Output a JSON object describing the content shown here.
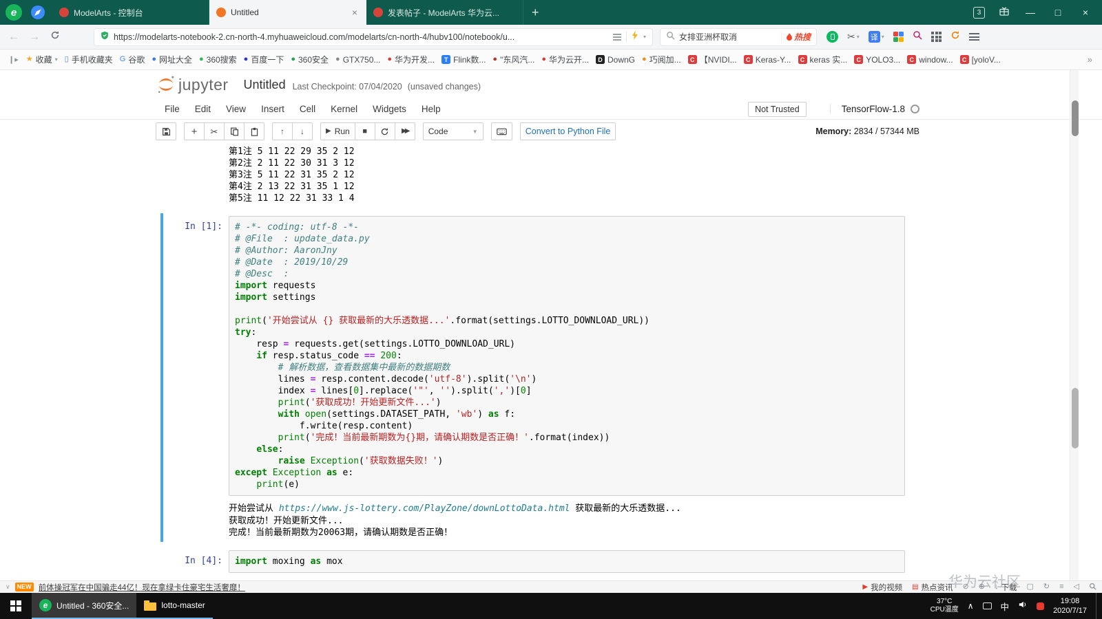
{
  "browser": {
    "tabs": {
      "tab1": {
        "title": "ModelArts - 控制台"
      },
      "tab2": {
        "title": "Untitled"
      },
      "tab3": {
        "title": "发表帖子 - ModelArts 华为云..."
      },
      "count_badge": "3"
    },
    "address": {
      "url": "https://modelarts-notebook-2.cn-north-4.myhuaweicloud.com/modelarts/cn-north-4/hubv100/notebook/u...",
      "search_text": "女排亚洲杯取消",
      "hot_label": "热搜",
      "translate_label": "译"
    },
    "bookmarks": [
      {
        "glyph": "★",
        "color": "#f5a623",
        "label": "收藏",
        "caret": "▾"
      },
      {
        "glyph": "▯",
        "color": "#4a90d9",
        "label": "手机收藏夹"
      },
      {
        "glyph": "G",
        "color": "#4285f4",
        "label": "谷歌"
      },
      {
        "glyph": "●",
        "color": "#3b78e7",
        "label": "网址大全"
      },
      {
        "glyph": "●",
        "color": "#2fb457",
        "label": "360搜索"
      },
      {
        "glyph": "●",
        "color": "#2932e1",
        "label": "百度一下"
      },
      {
        "glyph": "●",
        "color": "#25a35a",
        "label": "360安全"
      },
      {
        "glyph": "●",
        "color": "#8a8a8a",
        "label": "GTX750..."
      },
      {
        "glyph": "●",
        "color": "#d43f3a",
        "label": "华为开发..."
      },
      {
        "badge": "T",
        "bg": "#2d7ff9",
        "label": "Flink数..."
      },
      {
        "glyph": "●",
        "color": "#b03a2e",
        "label": "\"东风汽..."
      },
      {
        "glyph": "●",
        "color": "#d43f3a",
        "label": "华为云开..."
      },
      {
        "badge": "D",
        "bg": "#222222",
        "label": "DownG"
      },
      {
        "glyph": "●",
        "color": "#f08a24",
        "label": "巧阅加..."
      },
      {
        "badge": "C",
        "bg": "#dd3c3c",
        "label": "【NVIDI..."
      },
      {
        "badge": "C",
        "bg": "#dd3c3c",
        "label": "Keras-Y..."
      },
      {
        "badge": "C",
        "bg": "#dd3c3c",
        "label": "keras 实..."
      },
      {
        "badge": "C",
        "bg": "#dd3c3c",
        "label": "YOLO3..."
      },
      {
        "badge": "C",
        "bg": "#dd3c3c",
        "label": "window..."
      },
      {
        "badge": "C",
        "bg": "#dd3c3c",
        "label": "[yoloV..."
      }
    ],
    "news": {
      "badge": "NEW",
      "headline": "前体操冠军在中国骗走44亿！现在拿绿卡住豪宅生活奢靡！",
      "my_videos": "我的视频",
      "hot_news": "热点资讯",
      "download": "下载"
    }
  },
  "jupyter": {
    "logo_text": "jupyter",
    "title": "Untitled",
    "checkpoint": "Last Checkpoint: 07/04/2020",
    "unsaved": "(unsaved changes)",
    "menus": [
      "File",
      "Edit",
      "View",
      "Insert",
      "Cell",
      "Kernel",
      "Widgets",
      "Help"
    ],
    "not_trusted": "Not Trusted",
    "kernel_name": "TensorFlow-1.8",
    "toolbar": {
      "run_label": "Run",
      "cell_type": "Code",
      "convert_label": "Convert to Python File",
      "memory_label": "Memory:",
      "memory_value": "2834 / 57344 MB"
    },
    "cells": {
      "prev_output": [
        "第1注 5 11 22 29 35 2 12",
        "第2注 2 11 22 30 31 3 12",
        "第3注 5 11 22 31 35 2 12",
        "第4注 2 13 22 31 35 1 12",
        "第5注 11 12 22 31 33 1 4"
      ],
      "cell1": {
        "prompt": "In [1]:",
        "code_lines": [
          [
            [
              "c",
              "# -*- coding: utf-8 -*-"
            ]
          ],
          [
            [
              "c",
              "# @File  : update_data.py"
            ]
          ],
          [
            [
              "c",
              "# @Author: AaronJny"
            ]
          ],
          [
            [
              "c",
              "# @Date  : 2019/10/29"
            ]
          ],
          [
            [
              "c",
              "# @Desc  :"
            ]
          ],
          [
            [
              "k",
              "import"
            ],
            [
              "p",
              " requests"
            ]
          ],
          [
            [
              "k",
              "import"
            ],
            [
              "p",
              " settings"
            ]
          ],
          [
            [
              "p",
              ""
            ]
          ],
          [
            [
              "b",
              "print"
            ],
            [
              "p",
              "("
            ],
            [
              "s",
              "'开始尝试从 {} 获取最新的大乐透数据...'"
            ],
            [
              "p",
              ".format(settings.LOTTO_DOWNLOAD_URL))"
            ]
          ],
          [
            [
              "k",
              "try"
            ],
            [
              "p",
              ":"
            ]
          ],
          [
            [
              "p",
              "    resp "
            ],
            [
              "o",
              "="
            ],
            [
              "p",
              " requests.get(settings.LOTTO_DOWNLOAD_URL)"
            ]
          ],
          [
            [
              "p",
              "    "
            ],
            [
              "k",
              "if"
            ],
            [
              "p",
              " resp.status_code "
            ],
            [
              "o",
              "=="
            ],
            [
              "p",
              " "
            ],
            [
              "n",
              "200"
            ],
            [
              "p",
              ":"
            ]
          ],
          [
            [
              "p",
              "        "
            ],
            [
              "c",
              "# 解析数据，查看数据集中最新的数据期数"
            ]
          ],
          [
            [
              "p",
              "        lines "
            ],
            [
              "o",
              "="
            ],
            [
              "p",
              " resp.content.decode("
            ],
            [
              "s",
              "'utf-8'"
            ],
            [
              "p",
              ").split("
            ],
            [
              "s",
              "'\\n'"
            ],
            [
              "p",
              ")"
            ]
          ],
          [
            [
              "p",
              "        index "
            ],
            [
              "o",
              "="
            ],
            [
              "p",
              " lines["
            ],
            [
              "n",
              "0"
            ],
            [
              "p",
              "].replace("
            ],
            [
              "s",
              "'\"'"
            ],
            [
              "p",
              ", "
            ],
            [
              "s",
              "''"
            ],
            [
              "p",
              ").split("
            ],
            [
              "s",
              "','"
            ],
            [
              "p",
              ")["
            ],
            [
              "n",
              "0"
            ],
            [
              "p",
              "]"
            ]
          ],
          [
            [
              "p",
              "        "
            ],
            [
              "b",
              "print"
            ],
            [
              "p",
              "("
            ],
            [
              "s",
              "'获取成功！开始更新文件...'"
            ],
            [
              "p",
              ")"
            ]
          ],
          [
            [
              "p",
              "        "
            ],
            [
              "k",
              "with"
            ],
            [
              "p",
              " "
            ],
            [
              "b",
              "open"
            ],
            [
              "p",
              "(settings.DATASET_PATH, "
            ],
            [
              "s",
              "'wb'"
            ],
            [
              "p",
              ") "
            ],
            [
              "k",
              "as"
            ],
            [
              "p",
              " f:"
            ]
          ],
          [
            [
              "p",
              "            f.write(resp.content)"
            ]
          ],
          [
            [
              "p",
              "        "
            ],
            [
              "b",
              "print"
            ],
            [
              "p",
              "("
            ],
            [
              "s",
              "'完成！当前最新期数为{}期，请确认期数是否正确！'"
            ],
            [
              "p",
              ".format(index))"
            ]
          ],
          [
            [
              "p",
              "    "
            ],
            [
              "k",
              "else"
            ],
            [
              "p",
              ":"
            ]
          ],
          [
            [
              "p",
              "        "
            ],
            [
              "k",
              "raise"
            ],
            [
              "p",
              " "
            ],
            [
              "b",
              "Exception"
            ],
            [
              "p",
              "("
            ],
            [
              "s",
              "'获取数据失败！'"
            ],
            [
              "p",
              ")"
            ]
          ],
          [
            [
              "k",
              "except"
            ],
            [
              "p",
              " "
            ],
            [
              "b",
              "Exception"
            ],
            [
              "p",
              " "
            ],
            [
              "k",
              "as"
            ],
            [
              "p",
              " e:"
            ]
          ],
          [
            [
              "p",
              "    "
            ],
            [
              "b",
              "print"
            ],
            [
              "p",
              "(e)"
            ]
          ]
        ],
        "output_lines": [
          [
            [
              "p",
              "开始尝试从 "
            ],
            [
              "url",
              "https://www.js-lottery.com/PlayZone/downLottoData.html"
            ],
            [
              "p",
              " 获取最新的大乐透数据..."
            ]
          ],
          "获取成功！开始更新文件...",
          "完成！当前最新期数为20063期，请确认期数是否正确！"
        ]
      },
      "cell2": {
        "prompt": "In [4]:",
        "code_lines": [
          [
            [
              "k",
              "import"
            ],
            [
              "p",
              " moxing "
            ],
            [
              "k",
              "as"
            ],
            [
              "p",
              " mox"
            ]
          ]
        ]
      }
    }
  },
  "taskbar": {
    "app1": "Untitled - 360安全...",
    "app2": "lotto-master",
    "cpu_temp": "37°C",
    "cpu_label": "CPU温度",
    "ime": "中",
    "time": "19:08",
    "date": "2020/7/17"
  },
  "watermark": "华为云社区"
}
